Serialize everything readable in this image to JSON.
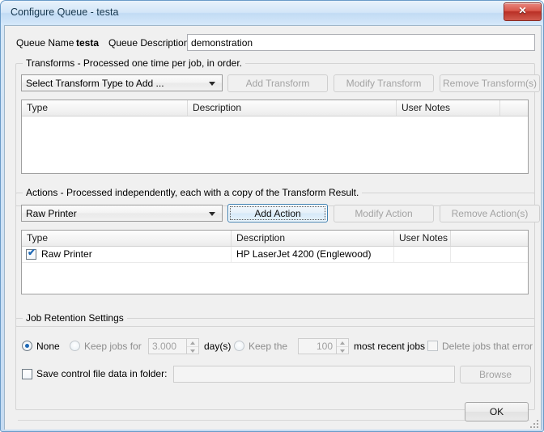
{
  "window": {
    "title": "Configure Queue - testa",
    "close_glyph": "✕",
    "accent_color": "#1d68b5"
  },
  "queue": {
    "name_label": "Queue Name",
    "name_value": "testa",
    "description_label": "Queue Description",
    "description_value": "demonstration",
    "description_placeholder": ""
  },
  "transforms": {
    "legend": "Transforms - Processed one time per job, in order.",
    "combo_value": "Select Transform Type to Add ...",
    "add_label": "Add Transform",
    "modify_label": "Modify Transform",
    "remove_label": "Remove Transform(s)",
    "columns": [
      "Type",
      "Description",
      "User Notes",
      ""
    ],
    "rows": []
  },
  "actions": {
    "legend": "Actions - Processed independently, each with a copy of the Transform Result.",
    "combo_value": "Raw Printer",
    "add_label": "Add Action",
    "modify_label": "Modify Action",
    "remove_label": "Remove Action(s)",
    "columns": [
      "Type",
      "Description",
      "User Notes",
      ""
    ],
    "rows": [
      {
        "checked": true,
        "type": "Raw Printer",
        "description": "HP LaserJet 4200 (Englewood)",
        "user_notes": "",
        "extra": ""
      }
    ]
  },
  "retention": {
    "legend": "Job Retention Settings",
    "none_label": "None",
    "keep_for_label": "Keep jobs for",
    "days_value": "3.000",
    "days_unit_label": "day(s)",
    "keep_the_label": "Keep the",
    "count_value": "100",
    "most_recent_label": "most recent jobs",
    "delete_error_label": "Delete jobs that error",
    "selected": "none",
    "delete_error_checked": false,
    "save_control_label": "Save control file data in folder:",
    "save_control_checked": false,
    "folder_value": "",
    "browse_label": "Browse"
  },
  "footer": {
    "ok_label": "OK"
  }
}
